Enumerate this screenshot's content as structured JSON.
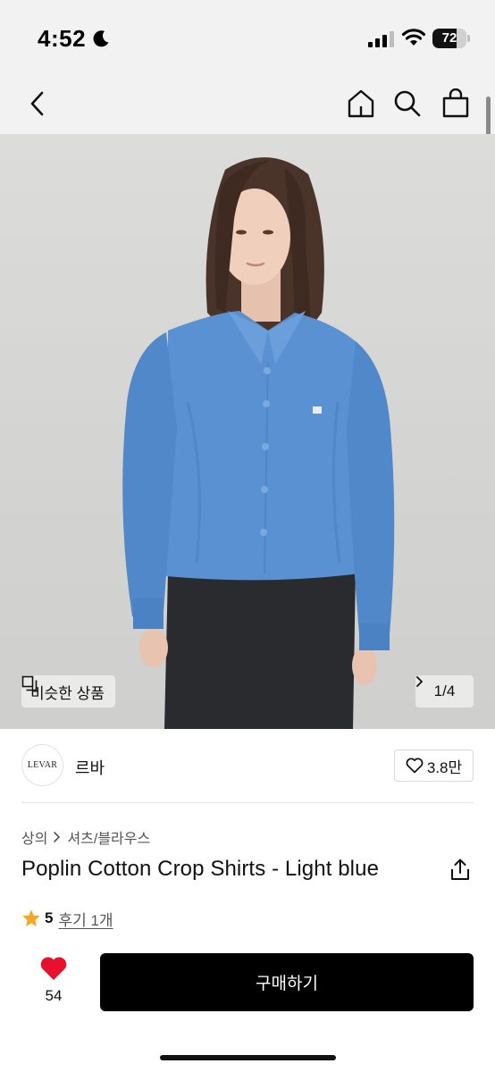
{
  "status_bar": {
    "time": "4:52",
    "battery": "72",
    "battery_level": 0.72
  },
  "nav": {
    "icons": [
      "back-icon",
      "home-icon",
      "search-icon",
      "shopping-bag-icon"
    ]
  },
  "gallery": {
    "similar_label": "비슷한 상품",
    "pager": "1/4"
  },
  "brand": {
    "logo_text": "LEVAR",
    "name": "르바",
    "likes": "3.8만"
  },
  "product": {
    "breadcrumb": [
      "상의",
      "셔츠/블라우스"
    ],
    "title": "Poplin Cotton Crop Shirts - Light blue",
    "rating": "5",
    "reviews": "후기 1개"
  },
  "bottom_bar": {
    "like_count": "54",
    "buy_label": "구매하기"
  },
  "colors": {
    "accent": "#000000",
    "heart": "#e8112d",
    "star": "#f5a623",
    "shirt": "#5a91d2"
  }
}
